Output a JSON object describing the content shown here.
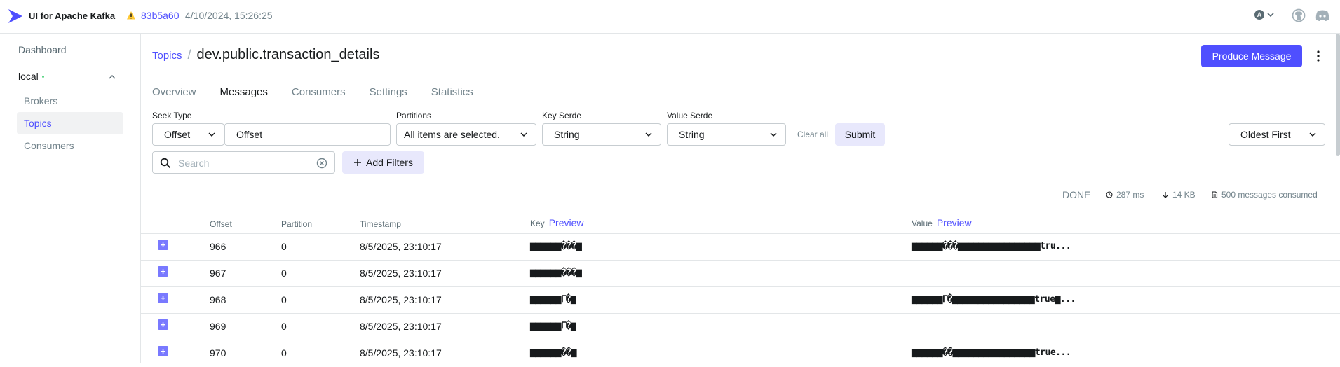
{
  "header": {
    "app_title": "UI for Apache Kafka",
    "commit": "83b5a60",
    "build_date": "4/10/2024, 15:26:25",
    "user_initial": "A"
  },
  "sidebar": {
    "dashboard": "Dashboard",
    "cluster": "local",
    "items": [
      {
        "label": "Brokers",
        "active": false
      },
      {
        "label": "Topics",
        "active": true
      },
      {
        "label": "Consumers",
        "active": false
      }
    ]
  },
  "page": {
    "breadcrumb_link": "Topics",
    "breadcrumb_sep": "/",
    "title": "dev.public.transaction_details",
    "produce_label": "Produce Message"
  },
  "tabs": [
    {
      "label": "Overview",
      "active": false
    },
    {
      "label": "Messages",
      "active": true
    },
    {
      "label": "Consumers",
      "active": false
    },
    {
      "label": "Settings",
      "active": false
    },
    {
      "label": "Statistics",
      "active": false
    }
  ],
  "filters": {
    "seek_type_label": "Seek Type",
    "seek_type_value": "Offset",
    "offset_value": "Offset",
    "partitions_label": "Partitions",
    "partitions_value": "All items are selected.",
    "key_serde_label": "Key Serde",
    "key_serde_value": "String",
    "value_serde_label": "Value Serde",
    "value_serde_value": "String",
    "clear_all": "Clear all",
    "submit": "Submit",
    "sort_value": "Oldest First",
    "search_placeholder": "Search",
    "add_filters": "Add Filters"
  },
  "stats": {
    "status": "DONE",
    "elapsed": "287 ms",
    "size": "14 KB",
    "consumed": "500 messages consumed"
  },
  "table": {
    "columns": {
      "offset": "Offset",
      "partition": "Partition",
      "timestamp": "Timestamp",
      "key": "Key",
      "value": "Value",
      "preview": "Preview"
    },
    "rows": [
      {
        "offset": "966",
        "partition": "0",
        "timestamp": "8/5/2025, 23:10:17",
        "key": "▆▆▆▆▆▆���▆",
        "value": "▆▆▆▆▆▆���▆▆▆▆▆▆▆▆▆▆▆▆▆▆▆▆tru..."
      },
      {
        "offset": "967",
        "partition": "0",
        "timestamp": "8/5/2025, 23:10:17",
        "key": "▆▆▆▆▆▆���▆",
        "value": ""
      },
      {
        "offset": "968",
        "partition": "0",
        "timestamp": "8/5/2025, 23:10:17",
        "key": "▆▆▆▆▆▆ᒥ�▆",
        "value": "▆▆▆▆▆▆ᒥ�▆▆▆▆▆▆▆▆▆▆▆▆▆▆▆▆true▆..."
      },
      {
        "offset": "969",
        "partition": "0",
        "timestamp": "8/5/2025, 23:10:17",
        "key": "▆▆▆▆▆▆ᒥ�▆",
        "value": ""
      },
      {
        "offset": "970",
        "partition": "0",
        "timestamp": "8/5/2025, 23:10:17",
        "key": "▆▆▆▆▆▆��▆",
        "value": "▆▆▆▆▆▆��▆▆▆▆▆▆▆▆▆▆▆▆▆▆▆▆true..."
      }
    ]
  },
  "colors": {
    "accent": "#4f4fff",
    "expand": "#7979ff"
  }
}
